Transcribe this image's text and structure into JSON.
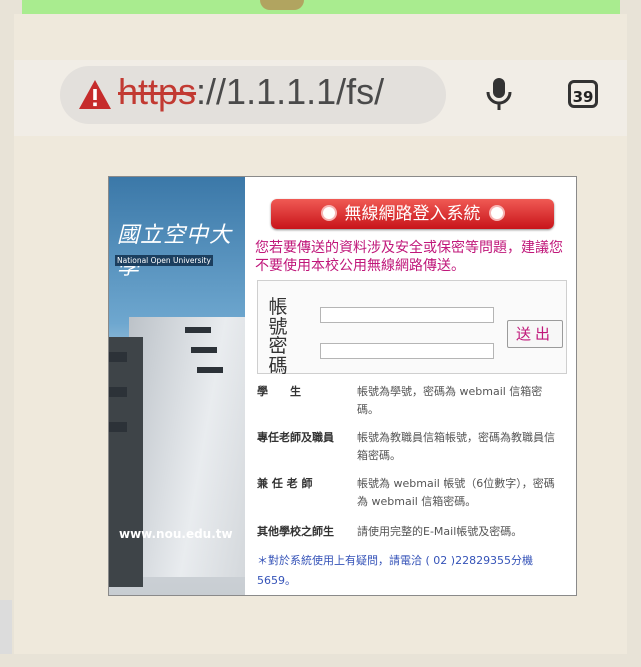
{
  "browser": {
    "url_scheme": "https",
    "url_rest": "://1.1.1.1/fs/",
    "tab_count": "39",
    "icons": [
      "warning-icon",
      "microphone-icon",
      "tabs-icon"
    ]
  },
  "side_logo": {
    "title": "國立空中大學",
    "subtitle": "National Open University",
    "web": "www.nou.edu.tw"
  },
  "login": {
    "title": "無線網路登入系統",
    "notice": "您若要傳送的資料涉及安全或保密等問題，建議您不要使用本校公用無線網路傳送。",
    "account_label": "帳號",
    "password_label": "密碼",
    "account_value": "",
    "password_value": "",
    "submit_label": "送出"
  },
  "info_rows": [
    {
      "key": "學　　生",
      "value": "帳號為學號，密碼為 webmail 信箱密碼。"
    },
    {
      "key": "專任老師及職員",
      "value": "帳號為教職員信箱帳號，密碼為教職員信箱密碼。"
    },
    {
      "key": "兼 任 老 師",
      "value": "帳號為 webmail 帳號（6位數字），密碼為 webmail 信箱密碼。"
    },
    {
      "key": "其他學校之師生",
      "value": "請使用完整的E-Mail帳號及密碼。"
    }
  ],
  "contact": "＊對於系統使用上有疑問，請電洽 ( 02 )22829355分機 5659。",
  "colors": {
    "accent_red": "#d3191f",
    "notice_magenta": "#c0177a",
    "contact_blue": "#3553b8"
  }
}
